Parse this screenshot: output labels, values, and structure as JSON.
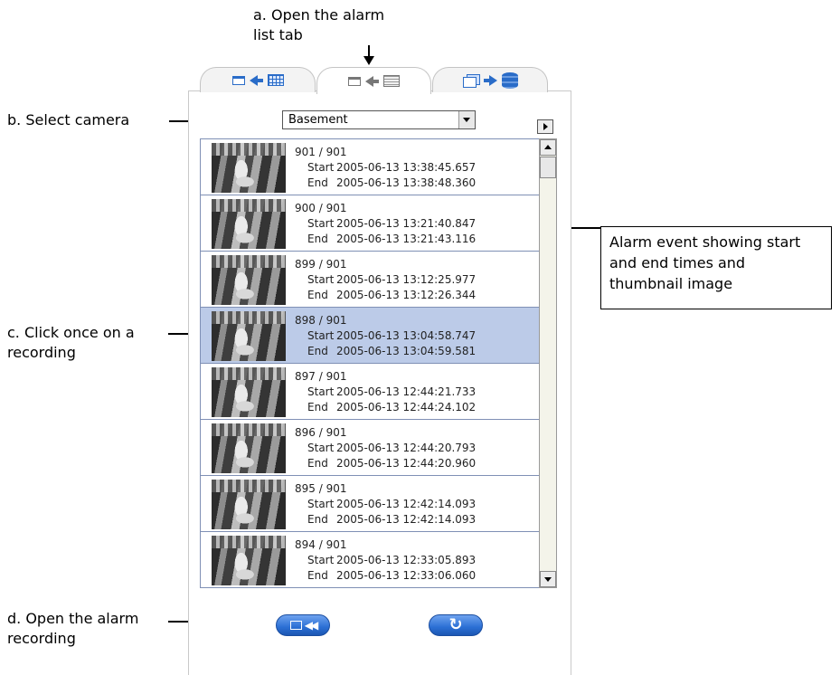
{
  "annotations": {
    "a": "a. Open the alarm\nlist tab",
    "b": "b. Select camera",
    "c": "c. Click once on a\nrecording",
    "d": "d. Open the alarm\nrecording",
    "callout": "Alarm event showing start\nand end times and\nthumbnail image"
  },
  "tabs": [
    {
      "icon": "window-arrow-grid-icon"
    },
    {
      "icon": "window-arrow-list-icon",
      "active": true
    },
    {
      "icon": "windows-arrow-database-icon"
    }
  ],
  "camera_select": {
    "value": "Basement"
  },
  "list": {
    "start_label": "Start",
    "end_label": "End",
    "items": [
      {
        "index": "901 / 901",
        "start": "2005-06-13 13:38:45.657",
        "end": "2005-06-13 13:38:48.360"
      },
      {
        "index": "900 / 901",
        "start": "2005-06-13 13:21:40.847",
        "end": "2005-06-13 13:21:43.116"
      },
      {
        "index": "899 / 901",
        "start": "2005-06-13 13:12:25.977",
        "end": "2005-06-13 13:12:26.344"
      },
      {
        "index": "898 / 901",
        "start": "2005-06-13 13:04:58.747",
        "end": "2005-06-13 13:04:59.581",
        "selected": true
      },
      {
        "index": "897 / 901",
        "start": "2005-06-13 12:44:21.733",
        "end": "2005-06-13 12:44:24.102"
      },
      {
        "index": "896 / 901",
        "start": "2005-06-13 12:44:20.793",
        "end": "2005-06-13 12:44:20.960"
      },
      {
        "index": "895 / 901",
        "start": "2005-06-13 12:42:14.093",
        "end": "2005-06-13 12:42:14.093"
      },
      {
        "index": "894 / 901",
        "start": "2005-06-13 12:33:05.893",
        "end": "2005-06-13 12:33:06.060"
      }
    ]
  },
  "buttons": {
    "open_recording": {
      "icon": "window-rewind-icon"
    },
    "refresh": {
      "icon": "refresh-icon",
      "glyph": "↻"
    }
  },
  "colors": {
    "accent": "#2b6fd4",
    "selected_row": "#bccbe8",
    "list_border": "#7f90b5"
  }
}
